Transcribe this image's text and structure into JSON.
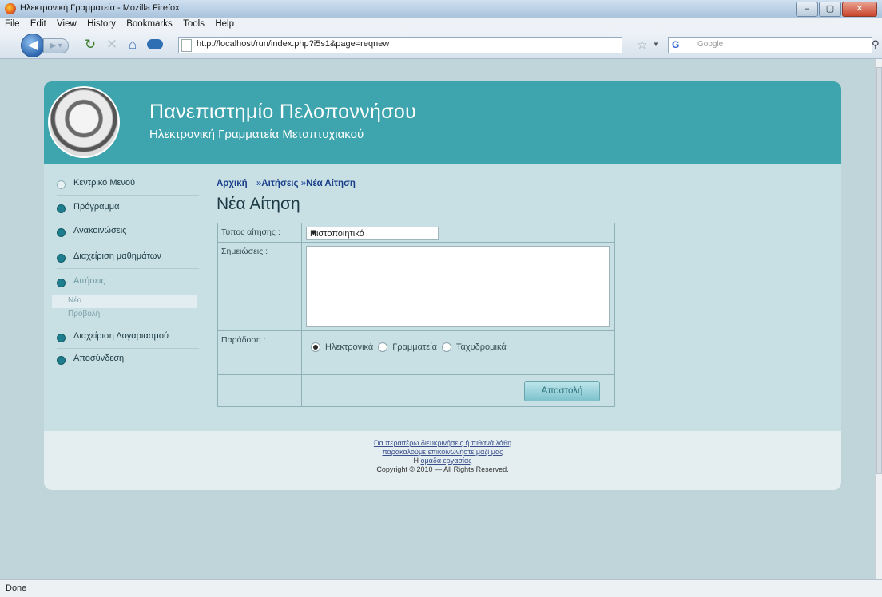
{
  "window": {
    "title": "Ηλεκτρονική Γραμματεία - Mozilla Firefox",
    "controls": [
      "–",
      "▢",
      "✕"
    ]
  },
  "menu": [
    "File",
    "Edit",
    "View",
    "History",
    "Bookmarks",
    "Tools",
    "Help"
  ],
  "nav": {
    "url": "http://localhost/run/index.php?i5s1&page=reqnew",
    "search_placeholder": "Google",
    "search_engine": "G"
  },
  "site": {
    "title": "Πανεπιστημίο Πελοποννήσου",
    "subtitle": "Ηλεκτρονική Γραμματεία Μεταπτυχιακού"
  },
  "sidebar": {
    "items": [
      {
        "label": "Κεντρικό Μενού",
        "style": "hollow"
      },
      {
        "label": "Πρόγραμμα",
        "style": "filled"
      },
      {
        "label": "Ανακοινώσεις",
        "style": "filled"
      },
      {
        "label": "Διαχείριση μαθημάτων",
        "style": "filled"
      },
      {
        "label": "Αιτήσεις",
        "style": "filled-dim"
      },
      {
        "label": "Διαχείριση Λογαριασμού",
        "style": "filled"
      },
      {
        "label": "Αποσύνδεση",
        "style": "filled"
      }
    ],
    "sub_items": [
      "Νέα",
      "Προβολή"
    ]
  },
  "breadcrumb": {
    "home": "Αρχική",
    "sep1": "»",
    "requests": "Αιτήσεις",
    "sep2": "»",
    "current": "Νέα Αίτηση"
  },
  "page_heading": "Νέα Αίτηση",
  "form": {
    "type_label": "Τύπος αίτησης :",
    "type_value": "Πιστοποιητικό",
    "notes_label": "Σημειώσεις :",
    "notes_value": "",
    "delivery_label": "Παράδοση :",
    "delivery_options": [
      "Ηλεκτρονικά",
      "Γραμματεία",
      "Ταχυδρομικά"
    ],
    "delivery_selected": "Ηλεκτρονικά",
    "submit_label": "Αποστολή"
  },
  "footer": {
    "line1": "Για περαιτέρω διευκρινήσεις ή πιθανά λάθη",
    "line2": "παρακαλούμε επικοινωνήστε μαζί μας",
    "line3_prefix": "Η ",
    "line3_link": "ομάδα εργασίας",
    "line4": "Copyright © 2010 — All Rights Reserved."
  },
  "status": "Done"
}
